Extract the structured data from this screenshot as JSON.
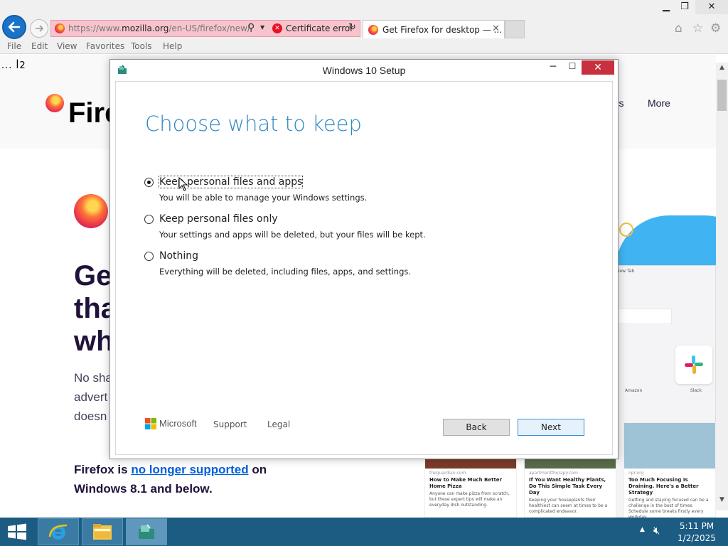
{
  "browser": {
    "url_prefix": "https://www.",
    "url_domain": "mozilla.org",
    "url_path": "/en-US/firefox/new/",
    "certificate_error": "Certificate error",
    "tab_title": "Get Firefox for desktop — ...",
    "menu": [
      "File",
      "Edit",
      "View",
      "Favorites",
      "Tools",
      "Help"
    ]
  },
  "webpage": {
    "top_dots": "... ꟾ2",
    "brand": "Fire",
    "nav_ers": "ers",
    "nav_more": "More",
    "hero_title": "Ge tha wh",
    "hero_text": "No sha advert doesn",
    "notice_prefix": "Firefox is ",
    "notice_link": "no longer supported",
    "notice_suffix": " on Windows 8.1 and below.",
    "preview": {
      "tab_label": "New Tab",
      "tiles": [
        "Amazon",
        "Slack"
      ],
      "cards": [
        {
          "source": "theguardian.com",
          "title": "How to Make Much Better Home Pizza",
          "desc": "Anyone can make pizza from scratch, but these expert tips will make an everyday dish outstanding."
        },
        {
          "source": "apartmenttherapy.com",
          "title": "If You Want Healthy Plants, Do This Simple Task Every Day",
          "desc": "Keeping your houseplants their healthiest can seem at times to be a complicated endeavor."
        },
        {
          "source": "npr.org",
          "title": "Too Much Focusing Is Draining. Here's a Better Strategy",
          "desc": "Getting and staying focused can be a challenge in the best of times. Schedule some breaks firstly every workday."
        }
      ]
    }
  },
  "dialog": {
    "title": "Windows 10 Setup",
    "heading": "Choose what to keep",
    "options": [
      {
        "label": "Keep personal files and apps",
        "desc": "You will be able to manage your Windows settings.",
        "selected": true
      },
      {
        "label": "Keep personal files only",
        "desc": "Your settings and apps will be deleted, but your files will be kept.",
        "selected": false
      },
      {
        "label": "Nothing",
        "desc": "Everything will be deleted, including files, apps, and settings.",
        "selected": false
      }
    ],
    "microsoft": "Microsoft",
    "support": "Support",
    "legal": "Legal",
    "back": "Back",
    "next": "Next"
  },
  "taskbar": {
    "time": "5:11 PM",
    "date": "1/2/2025"
  },
  "colors": {
    "accent_blue": "#2e87c3",
    "taskbar": "#1c5b82",
    "close_red": "#c7303f",
    "cert_error_bg": "#f7c4cd"
  }
}
